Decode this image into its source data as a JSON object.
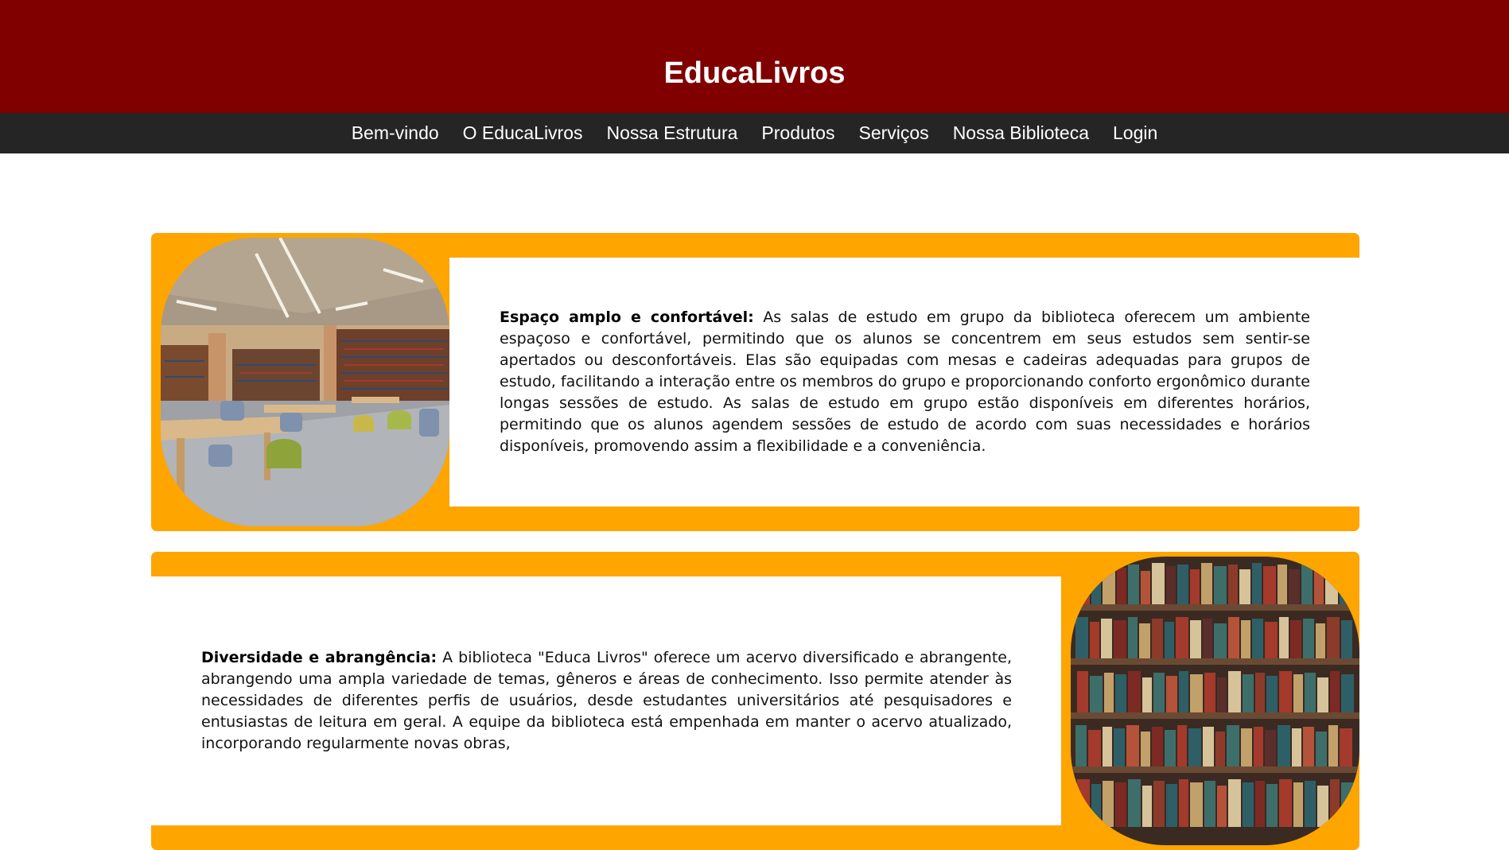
{
  "header": {
    "title": "EducaLivros"
  },
  "nav": {
    "items": [
      "Bem-vindo",
      "O EducaLivros",
      "Nossa Estrutura",
      "Produtos",
      "Serviços",
      "Nossa Biblioteca",
      "Login"
    ]
  },
  "sections": [
    {
      "heading": "Espaço amplo e confortável:",
      "body": "As salas de estudo em grupo da biblioteca oferecem um ambiente espaçoso e confortável, permitindo que os alunos se concentrem em seus estudos sem sentir-se apertados ou desconfortáveis. Elas são equipadas com mesas e cadeiras adequadas para grupos de estudo, facilitando a interação entre os membros do grupo e proporcionando conforto ergonômico durante longas sessões de estudo. As salas de estudo em grupo estão disponíveis em diferentes horários, permitindo que os alunos agendem sessões de estudo de acordo com suas necessidades e horários disponíveis, promovendo assim a flexibilidade e a conveniência."
    },
    {
      "heading": "Diversidade e abrangência:",
      "body": "A biblioteca \"Educa Livros\" oferece um acervo diversificado e abrangente, abrangendo uma ampla variedade de temas, gêneros e áreas de conhecimento. Isso permite atender às necessidades de diferentes perfis de usuários, desde estudantes universitários até pesquisadores e entusiastas de leitura em geral. A equipe da biblioteca está empenhada em manter o acervo atualizado, incorporando regularmente novas obras,"
    }
  ],
  "colors": {
    "header_bg": "#800000",
    "nav_bg": "#252525",
    "section_accent": "#ffa500"
  }
}
